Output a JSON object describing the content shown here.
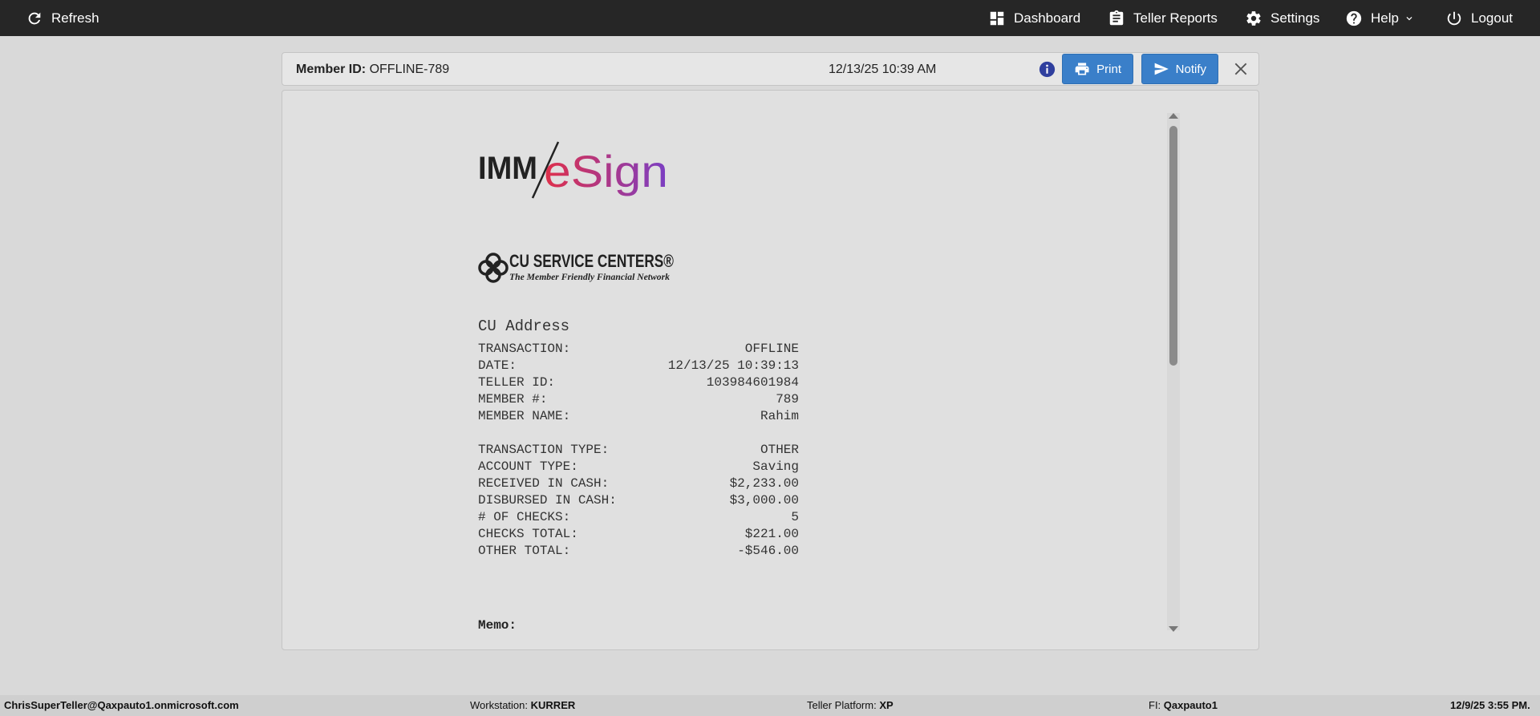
{
  "topbar": {
    "refresh_label": "Refresh",
    "dashboard_label": "Dashboard",
    "teller_reports_label": "Teller Reports",
    "settings_label": "Settings",
    "help_label": "Help",
    "logout_label": "Logout"
  },
  "header": {
    "member_id_label": "Member ID:",
    "member_id_value": "OFFLINE-789",
    "datetime": "12/13/25 10:39 AM",
    "print_label": "Print",
    "notify_label": "Notify"
  },
  "receipt": {
    "logo_primary": "IMM/eSign",
    "logo_secondary": "CU SERVICE CENTERS",
    "logo_secondary_tagline": "The Member Friendly Financial Network",
    "address": "CU Address",
    "rows_group1": [
      {
        "label": "TRANSACTION:",
        "value": "OFFLINE"
      },
      {
        "label": "DATE:",
        "value": "12/13/25 10:39:13"
      },
      {
        "label": "TELLER ID:",
        "value": "103984601984"
      },
      {
        "label": "MEMBER #:",
        "value": "789"
      },
      {
        "label": "MEMBER NAME:",
        "value": "Rahim"
      }
    ],
    "rows_group2": [
      {
        "label": "TRANSACTION TYPE:",
        "value": "OTHER"
      },
      {
        "label": "ACCOUNT TYPE:",
        "value": "Saving"
      },
      {
        "label": "RECEIVED IN CASH:",
        "value": "$2,233.00"
      },
      {
        "label": "DISBURSED IN CASH:",
        "value": "$3,000.00"
      },
      {
        "label": "# OF CHECKS:",
        "value": "5"
      },
      {
        "label": "CHECKS TOTAL:",
        "value": "$221.00"
      },
      {
        "label": "OTHER TOTAL:",
        "value": "-$546.00"
      }
    ],
    "memo_label": "Memo:"
  },
  "footer": {
    "user": "ChrisSuperTeller@Qaxpauto1.onmicrosoft.com",
    "workstation_label": "Workstation:",
    "workstation_value": "KURRER",
    "platform_label": "Teller Platform:",
    "platform_value": "XP",
    "fi_label": "FI:",
    "fi_value": "Qaxpauto1",
    "datetime": "12/9/25 3:55 PM."
  },
  "colors": {
    "topbar": "#262626",
    "accent_button": "#3a7fc9",
    "info_icon": "#2f3f9e",
    "esign_gradient_start": "#e0304a",
    "esign_gradient_end": "#7a3fc4"
  },
  "icons": [
    "refresh-icon",
    "dashboard-icon",
    "clipboard-icon",
    "gear-icon",
    "help-icon",
    "chevron-down-icon",
    "power-icon",
    "info-icon",
    "printer-icon",
    "send-icon",
    "close-icon"
  ]
}
